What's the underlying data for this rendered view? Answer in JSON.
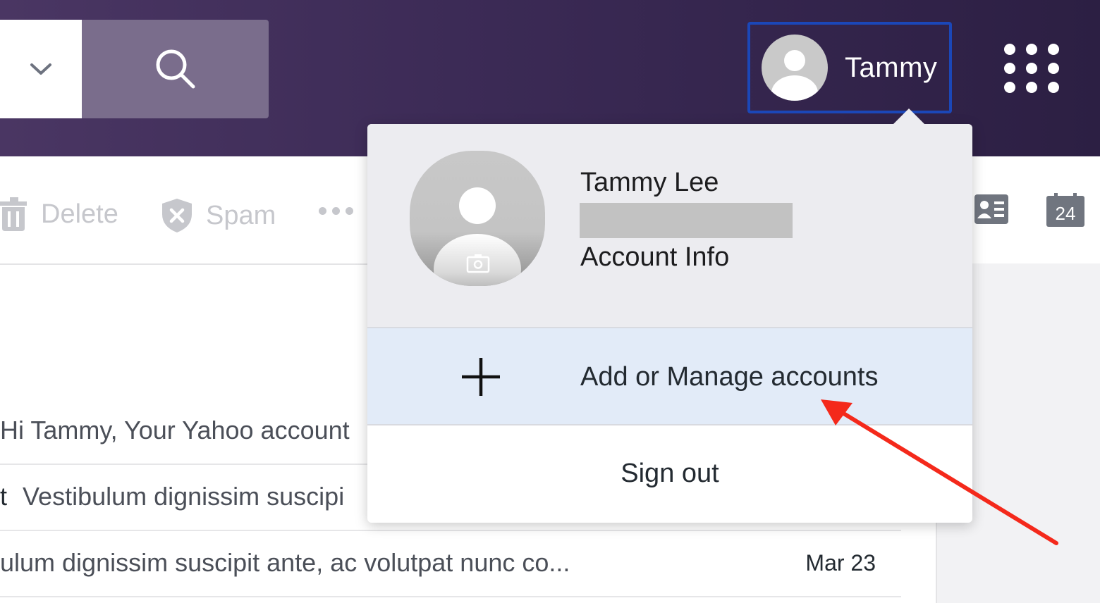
{
  "header": {
    "search_dropdown_icon": "chevron-down-icon",
    "search_icon": "search-icon",
    "profile_name": "Tammy",
    "apps_icon": "apps-grid-icon",
    "focus_border_color": "#1b47b8"
  },
  "toolbar": {
    "delete_label": "Delete",
    "spam_label": "Spam",
    "more_icon": "more-dots-icon",
    "contacts_icon": "contacts-icon",
    "calendar_day": "24"
  },
  "messages": [
    {
      "sender": "",
      "snippet": "Hi Tammy, Your Yahoo account",
      "date": ""
    },
    {
      "sender": "t",
      "snippet": "Vestibulum dignissim suscipi",
      "date": ""
    },
    {
      "sender": "",
      "snippet": "ulum dignissim suscipit ante, ac volutpat nunc co...",
      "date": "Mar 23"
    }
  ],
  "account_menu": {
    "full_name": "Tammy Lee",
    "account_info_label": "Account Info",
    "manage_accounts_label": "Add or Manage accounts",
    "sign_out_label": "Sign out",
    "camera_icon": "camera-icon",
    "plus_icon": "plus-icon",
    "highlight_color": "#e2ebf8"
  },
  "annotation": {
    "arrow_color": "#f4291b"
  }
}
